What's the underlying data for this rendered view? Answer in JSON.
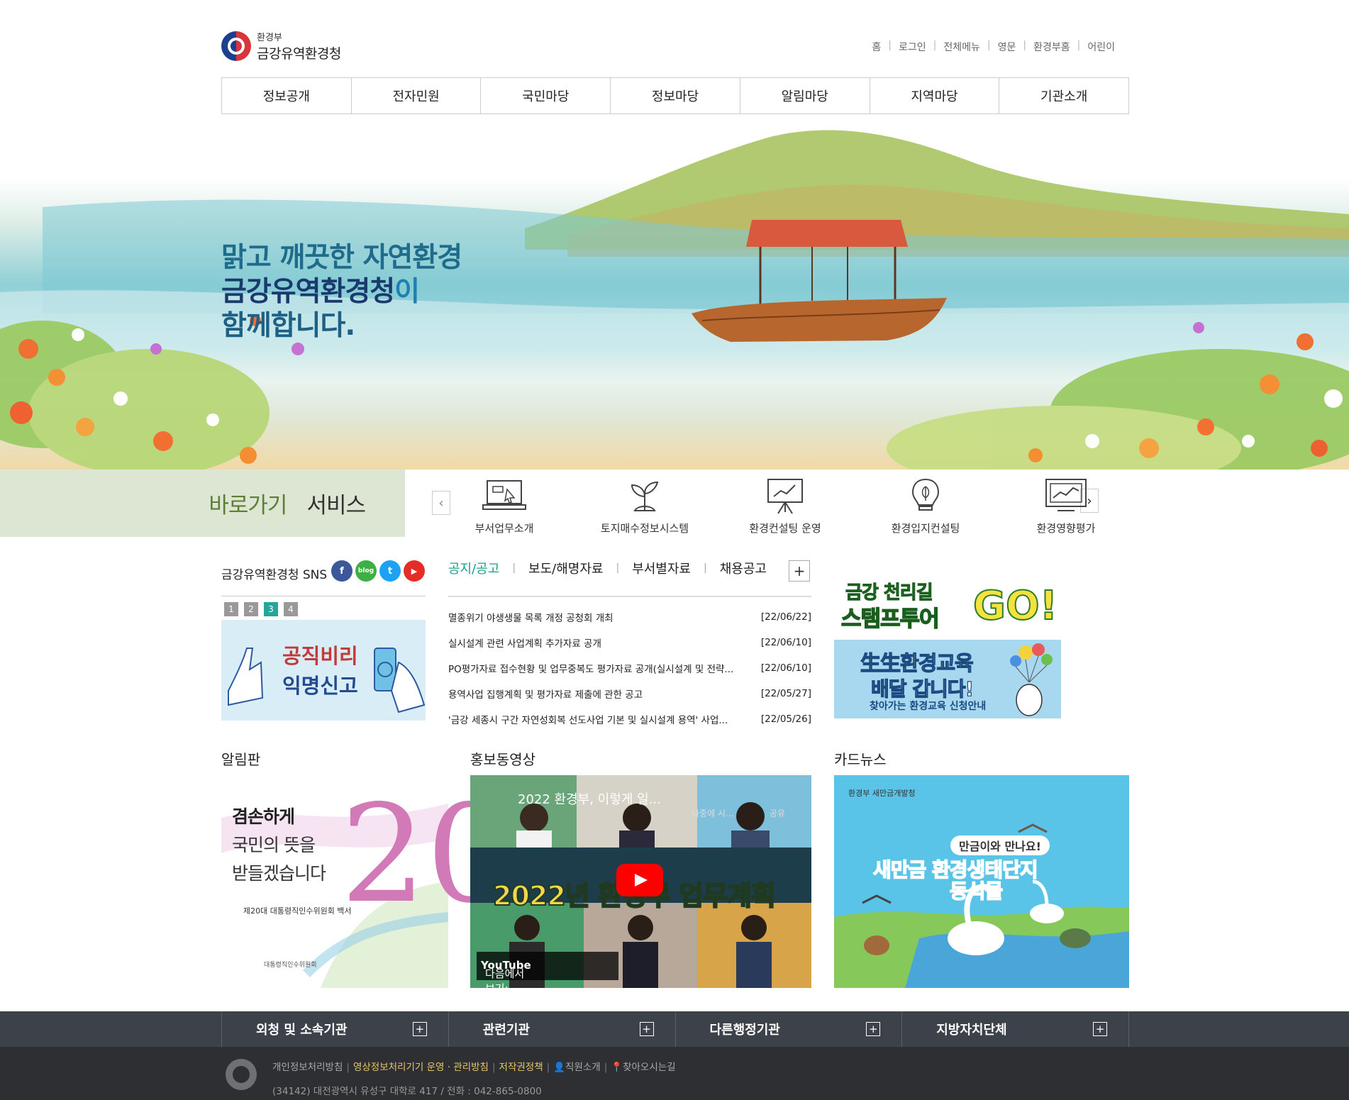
{
  "header": {
    "logo_small": "환경부",
    "logo_large": "금강유역환경청",
    "util_links": [
      "홈",
      "로그인",
      "전체메뉴",
      "영문",
      "환경부홈",
      "어린이"
    ]
  },
  "gnb": [
    "정보공개",
    "전자민원",
    "국민마당",
    "정보마당",
    "알림마당",
    "지역마당",
    "기관소개"
  ],
  "hero": {
    "line1": "맑고 깨끗한 자연환경",
    "line2_main": "금강유역환경청",
    "line2_suffix": "이",
    "line3": "함께합니다."
  },
  "quick": {
    "title_green": "바로가기",
    "title_dark": "서비스",
    "prev": "‹",
    "next": "›",
    "items": [
      {
        "label": "부서업무소개",
        "icon": "laptop-icon"
      },
      {
        "label": "토지매수정보시스템",
        "icon": "sprout-icon"
      },
      {
        "label": "환경컨설팅 운영",
        "icon": "presentation-icon"
      },
      {
        "label": "환경입지컨설팅",
        "icon": "lightbulb-leaf-icon"
      },
      {
        "label": "환경영향평가",
        "icon": "monitor-chart-icon"
      }
    ]
  },
  "sns": {
    "title": "금강유역환경청 SNS",
    "icons": [
      {
        "name": "facebook-icon",
        "glyph": "f",
        "color": "#3b5998"
      },
      {
        "name": "blog-icon",
        "glyph": "blog",
        "color": "#3cb043"
      },
      {
        "name": "twitter-icon",
        "glyph": "t",
        "color": "#1da1f2"
      },
      {
        "name": "youtube-icon",
        "glyph": "▶",
        "color": "#e52d27"
      }
    ],
    "pages": [
      "1",
      "2",
      "3",
      "4"
    ],
    "active_page": "3",
    "banner_line1": "공직비리",
    "banner_line2": "익명신고"
  },
  "notices": {
    "tabs": [
      "공지/공고",
      "보도/해명자료",
      "부서별자료",
      "채용공고"
    ],
    "active_tab": "공지/공고",
    "more": "+",
    "items": [
      {
        "title": "멸종위기 야생생물 목록 개정 공청회 개최",
        "date": "[22/06/22]"
      },
      {
        "title": "실시설계 관련 사업계획 추가자료 공개",
        "date": "[22/06/10]"
      },
      {
        "title": "PO평가자료 접수현황 및 업무중복도 평가자료 공개(실시설계 및 전략...",
        "date": "[22/06/10]"
      },
      {
        "title": "용역사업 집행계획 및 평가자료 제출에 관한 공고",
        "date": "[22/05/27]"
      },
      {
        "title": "'금강 세종시 구간 자연성회복 선도사업 기본 및 실시설계 용역' 사업...",
        "date": "[22/05/26]"
      }
    ]
  },
  "side_banners": {
    "go_line1": "금강 천리길",
    "go_line2": "스탬프투어",
    "go_go": "GO!",
    "edu_line1": "生生환경교육",
    "edu_line2": "배달 갑니다!",
    "edu_line3": "찾아가는 환경교육 신청안내"
  },
  "sections": {
    "board_title": "알림판",
    "video_title": "홍보동영상",
    "card_title": "카드뉴스"
  },
  "board": {
    "line1": "겸손하게",
    "line2": "국민의 뜻을",
    "line3": "받들겠습니다",
    "big": "20",
    "sub": "제20대 대통령직인수위원회 백서",
    "seal": "대통령직인수위원회"
  },
  "video": {
    "title": "2022 환경부, 이렇게 일...",
    "banner": "2022년 환경부 업무계획",
    "watch": "다음에서 보기:",
    "yt": "YouTube",
    "later": "나중에 시...",
    "share": "공유"
  },
  "card": {
    "logos": "환경부   새만금개발청",
    "line1": "만금이와 만나요!",
    "line2": "새만금 환경생태단지",
    "line3": "동식물"
  },
  "footer": {
    "groups": [
      "외청 및 소속기관",
      "관련기관",
      "다른행정기관",
      "지방자치단체"
    ],
    "plus": "+",
    "links": {
      "privacy": "개인정보처리방침",
      "cctv": "영상정보처리기기 운영 · 관리방침",
      "copyright": "저작권정책",
      "staff": "직원소개",
      "map": "찾아오시는길"
    },
    "address": "(34142) 대전광역시 유성구 대학로 417 / 전화 : 042-865-0800"
  }
}
